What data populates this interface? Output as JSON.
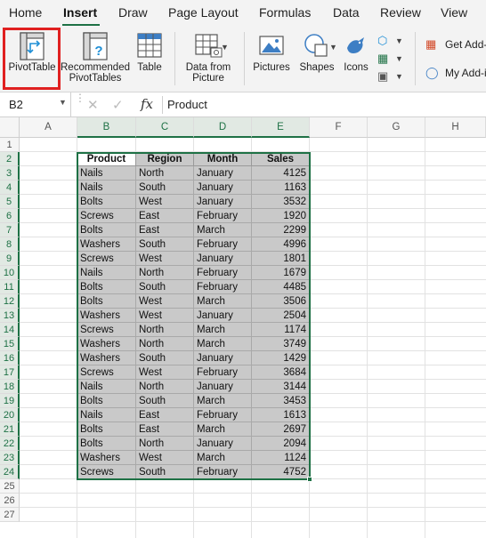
{
  "ribbon_tabs": [
    {
      "label": "Home",
      "active": false
    },
    {
      "label": "Insert",
      "active": true
    },
    {
      "label": "Draw",
      "active": false
    },
    {
      "label": "Page Layout",
      "active": false
    },
    {
      "label": "Formulas",
      "active": false
    },
    {
      "label": "Data",
      "active": false
    },
    {
      "label": "Review",
      "active": false
    },
    {
      "label": "View",
      "active": false
    }
  ],
  "ribbon": {
    "pivot_table": "PivotTable",
    "recommended_line1": "Recommended",
    "recommended_line2": "PivotTables",
    "table": "Table",
    "data_from_picture_line1": "Data from",
    "data_from_picture_line2": "Picture",
    "pictures": "Pictures",
    "shapes": "Shapes",
    "icons": "Icons",
    "get_addins": "Get Add-",
    "my_addins": "My Add-i"
  },
  "formula_bar": {
    "name_box": "B2",
    "fx_label": "fx",
    "content": "Product"
  },
  "columns": [
    "A",
    "B",
    "C",
    "D",
    "E",
    "F",
    "G",
    "H"
  ],
  "rows": [
    "1",
    "2",
    "3",
    "4",
    "5",
    "6",
    "7",
    "8",
    "9",
    "10",
    "11",
    "12",
    "13",
    "14",
    "15",
    "16",
    "17",
    "18",
    "19",
    "20",
    "21",
    "22",
    "23",
    "24",
    "25",
    "26",
    "27"
  ],
  "table": {
    "headers": [
      "Product",
      "Region",
      "Month",
      "Sales"
    ],
    "rows": [
      [
        "Nails",
        "North",
        "January",
        "4125"
      ],
      [
        "Nails",
        "South",
        "January",
        "1163"
      ],
      [
        "Bolts",
        "West",
        "January",
        "3532"
      ],
      [
        "Screws",
        "East",
        "February",
        "1920"
      ],
      [
        "Bolts",
        "East",
        "March",
        "2299"
      ],
      [
        "Washers",
        "South",
        "February",
        "4996"
      ],
      [
        "Screws",
        "West",
        "January",
        "1801"
      ],
      [
        "Nails",
        "North",
        "February",
        "1679"
      ],
      [
        "Bolts",
        "South",
        "February",
        "4485"
      ],
      [
        "Bolts",
        "West",
        "March",
        "3506"
      ],
      [
        "Washers",
        "West",
        "January",
        "2504"
      ],
      [
        "Screws",
        "North",
        "March",
        "1174"
      ],
      [
        "Washers",
        "North",
        "March",
        "3749"
      ],
      [
        "Washers",
        "South",
        "January",
        "1429"
      ],
      [
        "Screws",
        "West",
        "February",
        "3684"
      ],
      [
        "Nails",
        "North",
        "January",
        "3144"
      ],
      [
        "Bolts",
        "South",
        "March",
        "3453"
      ],
      [
        "Nails",
        "East",
        "February",
        "1613"
      ],
      [
        "Bolts",
        "East",
        "March",
        "2697"
      ],
      [
        "Bolts",
        "North",
        "January",
        "2094"
      ],
      [
        "Washers",
        "West",
        "March",
        "1124"
      ],
      [
        "Screws",
        "South",
        "February",
        "4752"
      ]
    ]
  },
  "colors": {
    "accent_green": "#1e7145",
    "highlight_red": "#e02020",
    "cell_shade": "#c9c9c9"
  }
}
